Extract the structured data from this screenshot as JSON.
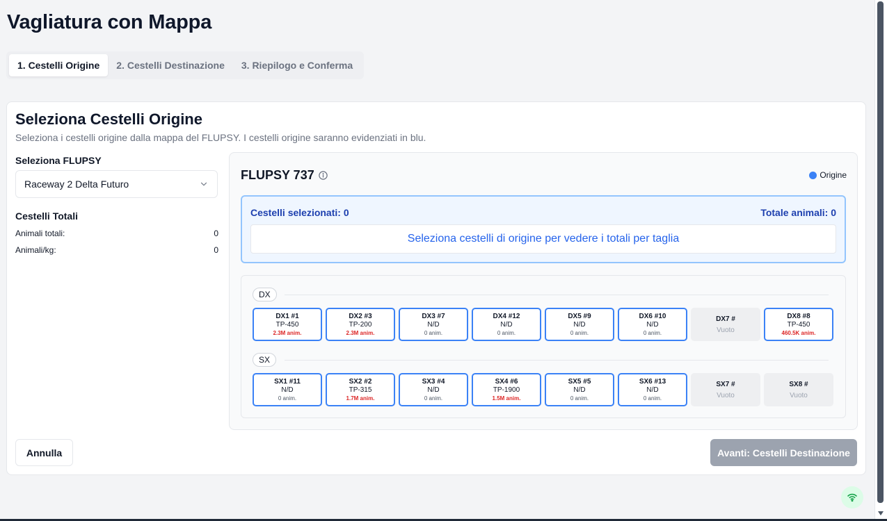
{
  "page_title": "Vagliatura con Mappa",
  "tabs": [
    {
      "label": "1. Cestelli Origine",
      "active": true
    },
    {
      "label": "2. Cestelli Destinazione",
      "active": false
    },
    {
      "label": "3. Riepilogo e Conferma",
      "active": false
    }
  ],
  "card": {
    "title": "Seleziona Cestelli Origine",
    "description": "Seleziona i cestelli origine dalla mappa del FLUPSY. I cestelli origine saranno evidenziati in blu."
  },
  "left": {
    "flupsy_label": "Seleziona FLUPSY",
    "flupsy_value": "Raceway 2 Delta Futuro",
    "totals_title": "Cestelli Totali",
    "animali_totali_label": "Animali totali:",
    "animali_totali_value": "0",
    "animali_kg_label": "Animali/kg:",
    "animali_kg_value": "0"
  },
  "map_panel": {
    "flupsy_name": "FLUPSY 737",
    "legend_label": "Origine",
    "legend_color": "#3b82f6",
    "selected_label": "Cestelli selezionati: 0",
    "total_animals_label": "Totale animali: 0",
    "hint": "Seleziona cestelli di origine per vedere i totali per taglia"
  },
  "rows": [
    {
      "label": "DX",
      "baskets": [
        {
          "name": "DX1 #1",
          "size": "TP-450",
          "animals": "2.3M anim.",
          "state": "full",
          "highlight": true
        },
        {
          "name": "DX2 #3",
          "size": "TP-200",
          "animals": "2.3M anim.",
          "state": "full",
          "highlight": true
        },
        {
          "name": "DX3 #7",
          "size": "N/D",
          "animals": "0 anim.",
          "state": "full",
          "highlight": false
        },
        {
          "name": "DX4 #12",
          "size": "N/D",
          "animals": "0 anim.",
          "state": "full",
          "highlight": false
        },
        {
          "name": "DX5 #9",
          "size": "N/D",
          "animals": "0 anim.",
          "state": "full",
          "highlight": false
        },
        {
          "name": "DX6 #10",
          "size": "N/D",
          "animals": "0 anim.",
          "state": "full",
          "highlight": false
        },
        {
          "name": "DX7 #",
          "empty_label": "Vuoto",
          "state": "empty"
        },
        {
          "name": "DX8 #8",
          "size": "TP-450",
          "animals": "460.5K anim.",
          "state": "full",
          "highlight": true
        }
      ]
    },
    {
      "label": "SX",
      "baskets": [
        {
          "name": "SX1 #11",
          "size": "N/D",
          "animals": "0 anim.",
          "state": "full",
          "highlight": false
        },
        {
          "name": "SX2 #2",
          "size": "TP-315",
          "animals": "1.7M anim.",
          "state": "full",
          "highlight": true
        },
        {
          "name": "SX3 #4",
          "size": "N/D",
          "animals": "0 anim.",
          "state": "full",
          "highlight": false
        },
        {
          "name": "SX4 #6",
          "size": "TP-1900",
          "animals": "1.5M anim.",
          "state": "full",
          "highlight": true
        },
        {
          "name": "SX5 #5",
          "size": "N/D",
          "animals": "0 anim.",
          "state": "full",
          "highlight": false
        },
        {
          "name": "SX6 #13",
          "size": "N/D",
          "animals": "0 anim.",
          "state": "full",
          "highlight": false
        },
        {
          "name": "SX7 #",
          "empty_label": "Vuoto",
          "state": "empty"
        },
        {
          "name": "SX8 #",
          "empty_label": "Vuoto",
          "state": "empty"
        }
      ]
    }
  ],
  "buttons": {
    "cancel": "Annulla",
    "next": "Avanti: Cestelli Destinazione"
  },
  "icons": {
    "info": "info-icon",
    "chevron": "chevron-down-icon",
    "status": "wifi-icon"
  }
}
